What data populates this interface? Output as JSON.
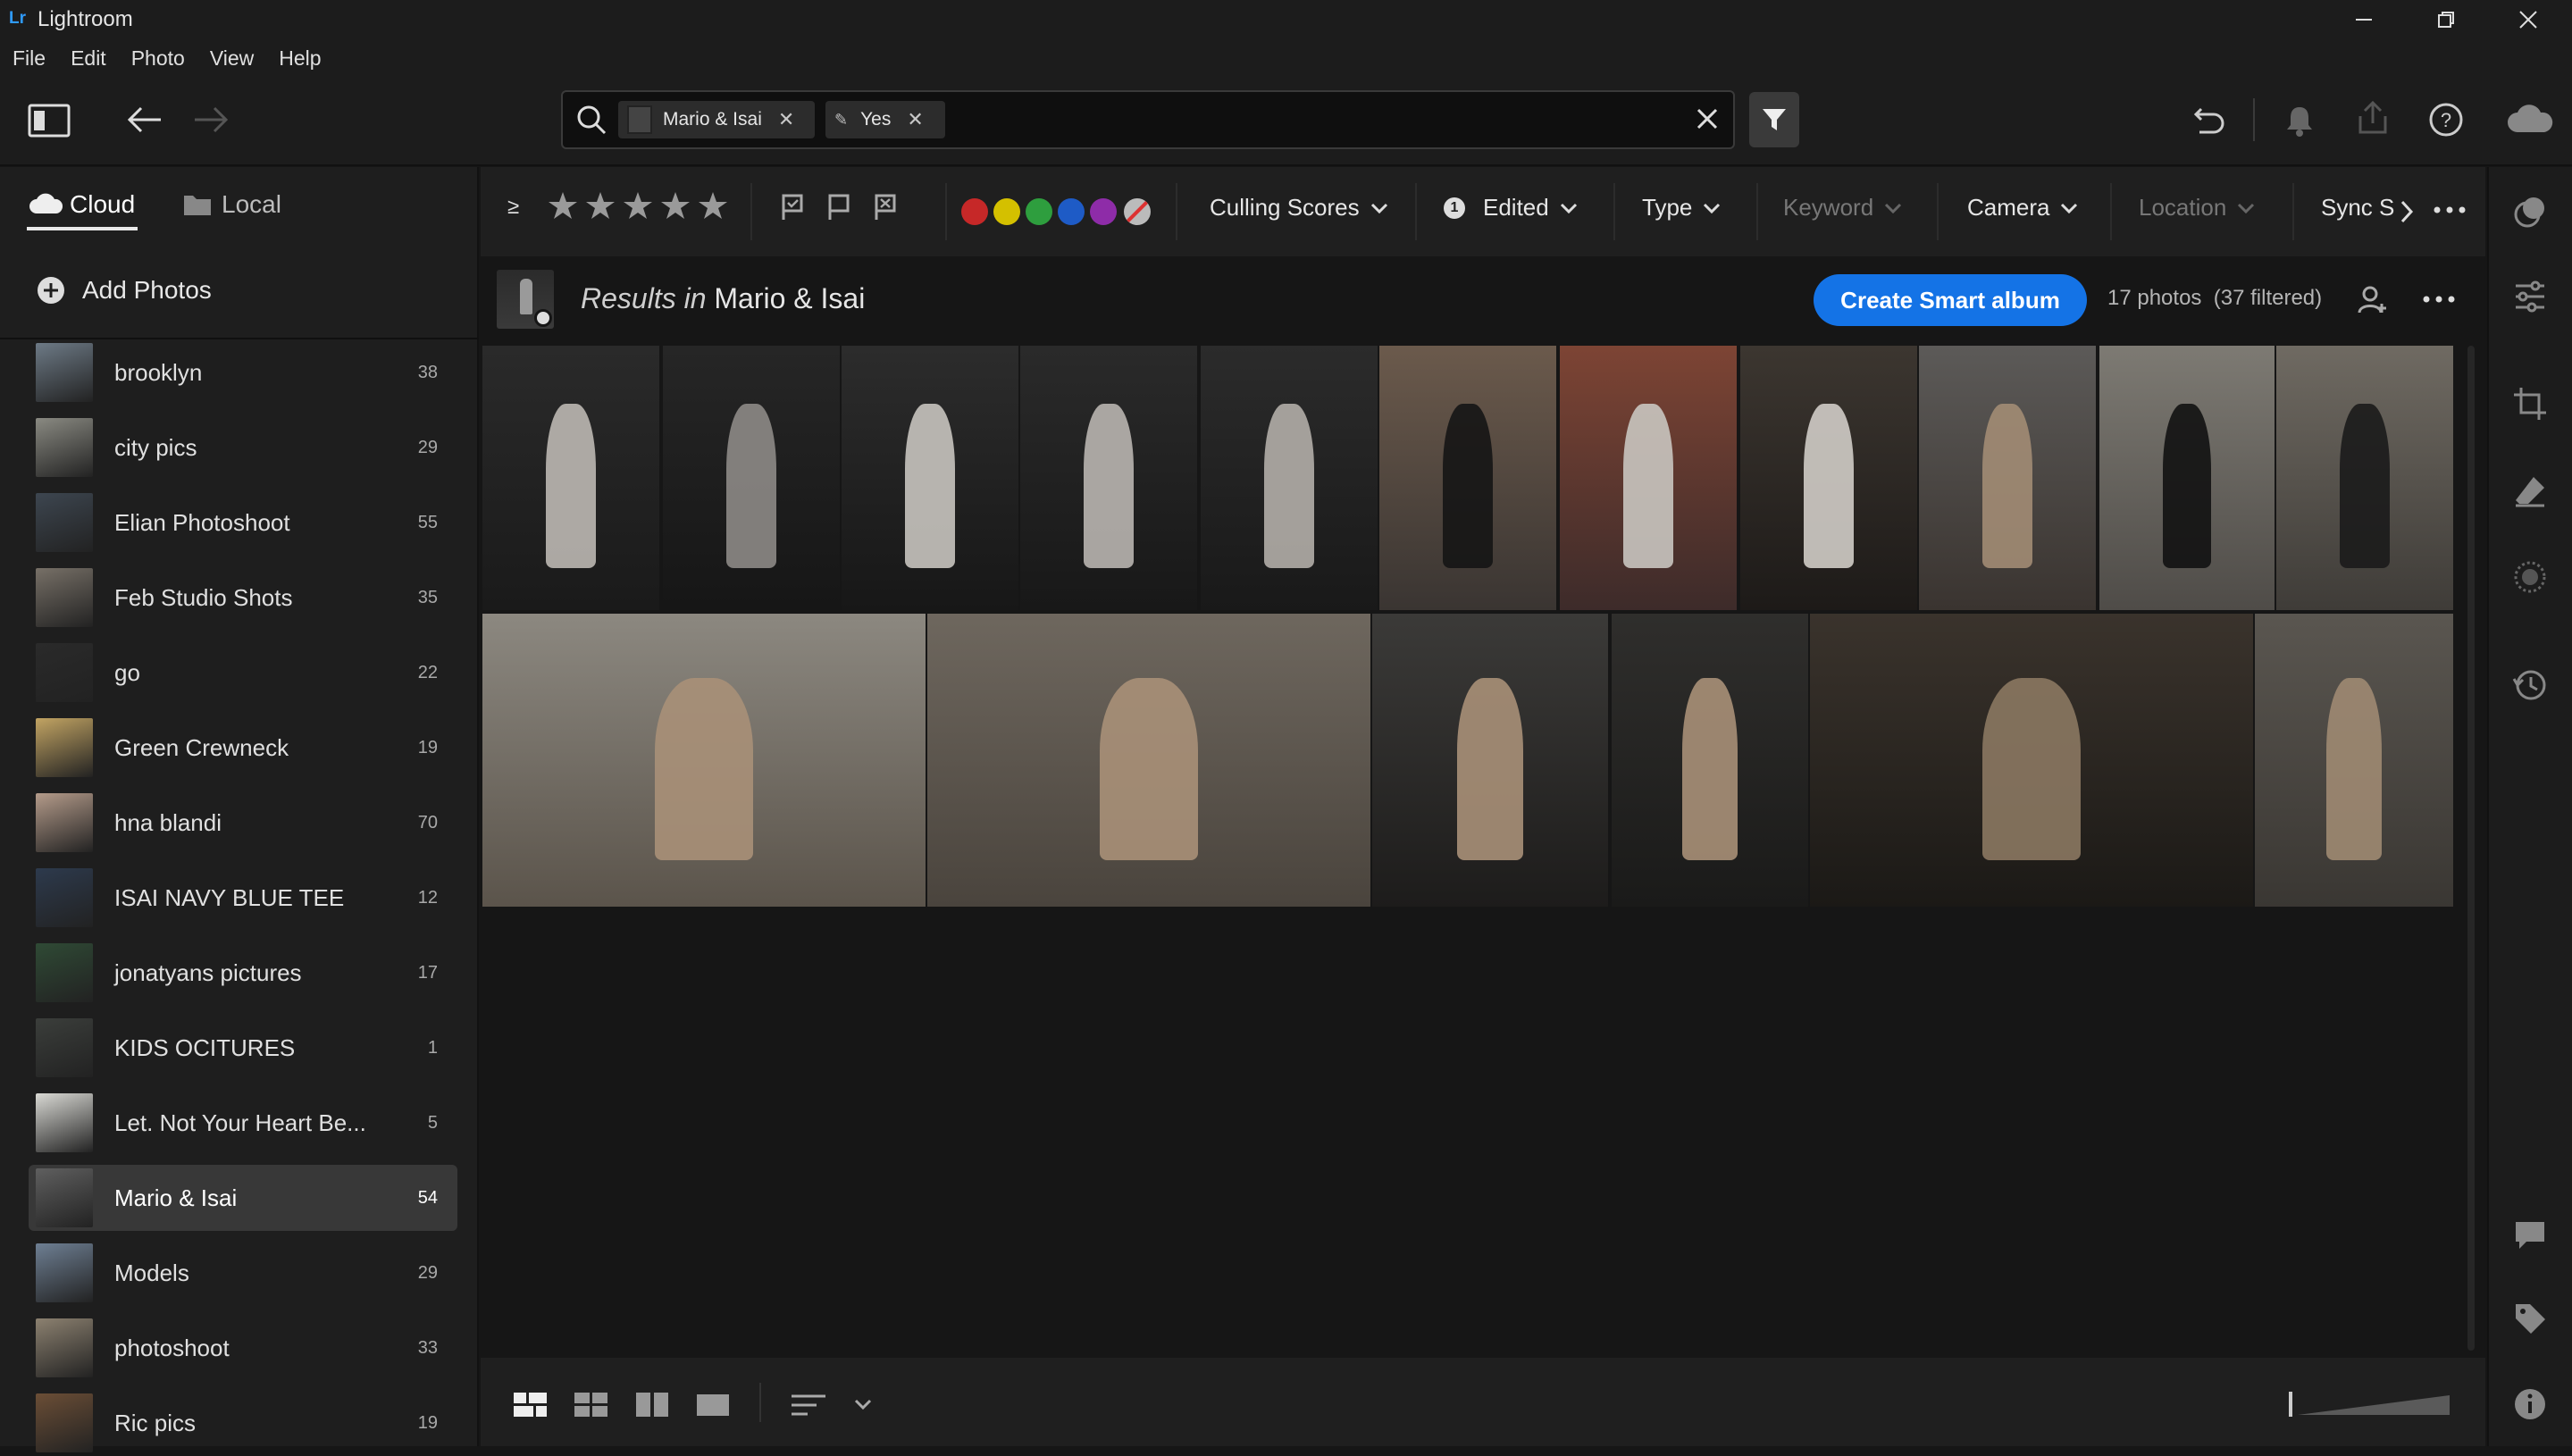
{
  "window": {
    "logo": "Lr",
    "title": "Lightroom"
  },
  "menu": [
    "File",
    "Edit",
    "Photo",
    "View",
    "Help"
  ],
  "search": {
    "chips": [
      {
        "label": "Mario & Isai",
        "icon": "album-thumb-icon"
      },
      {
        "label": "Yes",
        "icon": "pencil-icon"
      }
    ],
    "clear_icon": "close-icon"
  },
  "source_tabs": {
    "cloud": "Cloud",
    "local": "Local",
    "active": "Cloud"
  },
  "add_photos": "Add Photos",
  "albums": [
    {
      "name": "brooklyn",
      "count": "38"
    },
    {
      "name": "city pics",
      "count": "29"
    },
    {
      "name": "Elian Photoshoot",
      "count": "55"
    },
    {
      "name": "Feb Studio Shots",
      "count": "35"
    },
    {
      "name": "go",
      "count": "22"
    },
    {
      "name": "Green Crewneck",
      "count": "19"
    },
    {
      "name": "hna blandi",
      "count": "70"
    },
    {
      "name": "ISAI NAVY BLUE TEE",
      "count": "12"
    },
    {
      "name": "jonatyans pictures",
      "count": "17"
    },
    {
      "name": "KIDS OCITURES",
      "count": "1"
    },
    {
      "name": "Let. Not Your Heart Be...",
      "count": "5"
    },
    {
      "name": "Mario & Isai",
      "count": "54",
      "selected": true
    },
    {
      "name": "Models",
      "count": "29"
    },
    {
      "name": "photoshoot",
      "count": "33"
    },
    {
      "name": "Ric pics",
      "count": "19"
    }
  ],
  "filters": {
    "rating_operator": "≥",
    "stars": 5,
    "color_labels": [
      "#c62828",
      "#d4c000",
      "#2e9e3e",
      "#1e5bc6",
      "#8e2ca8"
    ],
    "culling": "Culling Scores",
    "edited_badge": "1",
    "edited": "Edited",
    "type": "Type",
    "keyword": "Keyword",
    "camera": "Camera",
    "location": "Location",
    "sync": "Sync S"
  },
  "results": {
    "prefix": "Results in",
    "album": "Mario & Isai",
    "create_button": "Create Smart album",
    "count_text": "17 photos  (37 filtered)"
  },
  "photos": [
    {
      "scene": "studio-hoodie-front"
    },
    {
      "scene": "studio-hoodie-back-dark"
    },
    {
      "scene": "studio-hoodie-back"
    },
    {
      "scene": "studio-two-sitting"
    },
    {
      "scene": "studio-two-sitting-2"
    },
    {
      "scene": "alley-god-was-always-there"
    },
    {
      "scene": "brick-wall-stairs"
    },
    {
      "scene": "abandoned-doorway"
    },
    {
      "scene": "graffiti-portrait"
    },
    {
      "scene": "road-walking-black-hoodie"
    },
    {
      "scene": "car-hood-two"
    },
    {
      "scene": "two-walking-road"
    },
    {
      "scene": "two-walking-gravel"
    },
    {
      "scene": "graffiti-wall-two"
    },
    {
      "scene": "graffiti-wall-two-2"
    },
    {
      "scene": "car-door-night"
    },
    {
      "scene": "road-standing-hoodie"
    }
  ]
}
